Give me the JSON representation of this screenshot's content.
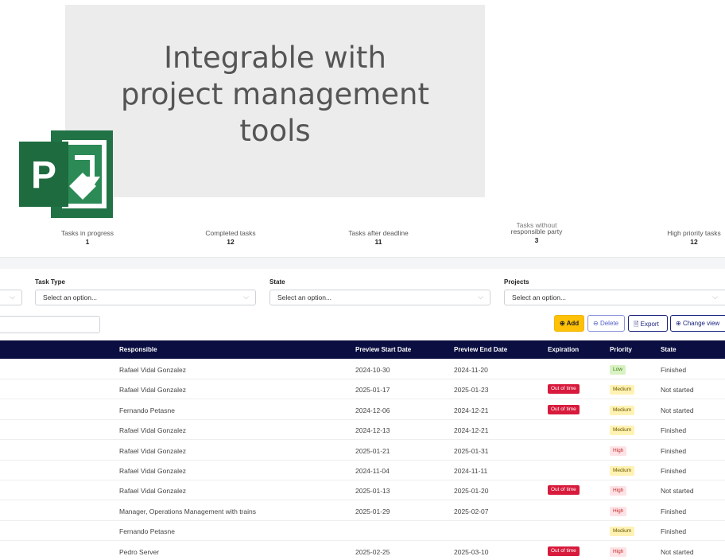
{
  "promo": {
    "line1": "Integrable with",
    "line2": "project management",
    "line3": "tools",
    "logo_icon": "ms-project-logo-icon",
    "logo_letter": "P"
  },
  "stats": [
    {
      "label": "Tasks in progress",
      "value": "1"
    },
    {
      "label": "Completed tasks",
      "value": "12"
    },
    {
      "label": "Tasks after deadline",
      "value": "11"
    },
    {
      "label_top": "Tasks without",
      "label": "responsible party",
      "value": "3"
    },
    {
      "label": "High priority tasks",
      "value": "12"
    }
  ],
  "filters": {
    "task_type": {
      "label": "Task Type",
      "placeholder": "Select an option..."
    },
    "state": {
      "label": "State",
      "placeholder": "Select an option..."
    },
    "projects": {
      "label": "Projects",
      "placeholder": "Select an option..."
    }
  },
  "toolbar": {
    "add": "Add",
    "delete": "Delete",
    "export": "Export",
    "change_view": "Change view"
  },
  "table": {
    "columns": {
      "responsible": "Responsible",
      "start": "Preview Start Date",
      "end": "Preview End Date",
      "expiration": "Expiration",
      "priority": "Priority",
      "state": "State"
    },
    "rows": [
      {
        "responsible": "Rafael Vidal Gonzalez",
        "start": "2024-10-30",
        "end": "2024-11-20",
        "expiration": "",
        "priority": "Low",
        "state": "Finished"
      },
      {
        "responsible": "Rafael Vidal Gonzalez",
        "start": "2025-01-17",
        "end": "2025-01-23",
        "expiration": "Out of time",
        "priority": "Medium",
        "state": "Not started"
      },
      {
        "responsible": "Fernando Petasne",
        "start": "2024-12-06",
        "end": "2024-12-21",
        "expiration": "Out of time",
        "priority": "Medium",
        "state": "Not started"
      },
      {
        "responsible": "Rafael Vidal Gonzalez",
        "start": "2024-12-13",
        "end": "2024-12-21",
        "expiration": "",
        "priority": "Medium",
        "state": "Finished"
      },
      {
        "responsible": "Rafael Vidal Gonzalez",
        "start": "2025-01-21",
        "end": "2025-01-31",
        "expiration": "",
        "priority": "High",
        "state": "Finished"
      },
      {
        "responsible": "Rafael Vidal Gonzalez",
        "start": "2024-11-04",
        "end": "2024-11-11",
        "expiration": "",
        "priority": "Medium",
        "state": "Finished"
      },
      {
        "responsible": "Rafael Vidal Gonzalez",
        "start": "2025-01-13",
        "end": "2025-01-20",
        "expiration": "Out of time",
        "priority": "High",
        "state": "Not started"
      },
      {
        "responsible": "Manager, Operations Management with trains",
        "start": "2025-01-29",
        "end": "2025-02-07",
        "expiration": "",
        "priority": "High",
        "state": "Finished"
      },
      {
        "responsible": "Fernando Petasne",
        "start": "",
        "end": "",
        "expiration": "",
        "priority": "Medium",
        "state": "Finished"
      },
      {
        "responsible": "Pedro Server",
        "start": "2025-02-25",
        "end": "2025-03-10",
        "expiration": "Out of time",
        "priority": "High",
        "state": "Not started"
      }
    ]
  },
  "colors": {
    "header_bg": "#0a0e40",
    "accent_add": "#ffc107",
    "out_of_time": "#d81b3c",
    "logo_green": "#217346"
  }
}
